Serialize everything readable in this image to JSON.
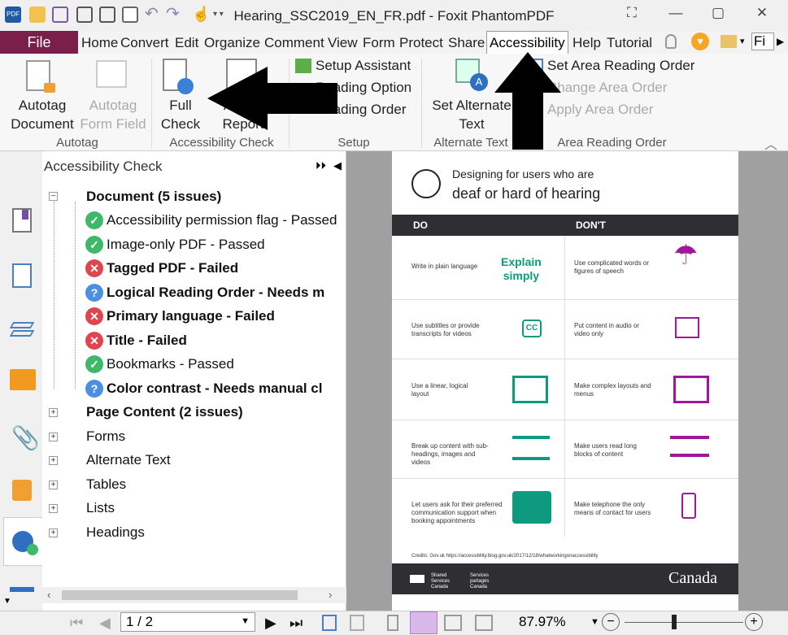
{
  "window": {
    "title": "Hearing_SSC2019_EN_FR.pdf - Foxit PhantomPDF",
    "search_tab": "Fi"
  },
  "menu": {
    "file": "File",
    "items": [
      "Home",
      "Convert",
      "Edit",
      "Organize",
      "Comment",
      "View",
      "Form",
      "Protect",
      "Share"
    ],
    "active": "Accessibility",
    "after": [
      "Help",
      "Tutorial"
    ]
  },
  "ribbon": {
    "autotag_document": [
      "Autotag",
      "Document"
    ],
    "autotag_form_field": [
      "Autotag",
      "Form Field"
    ],
    "group_autotag": "Autotag",
    "full_check": [
      "Full",
      "Check"
    ],
    "accessibility_report": [
      "Acc",
      "Report"
    ],
    "group_check": "Accessibility Check",
    "setup_assistant": "Setup Assistant",
    "reading_option": "Reading Option",
    "reading_order": "Reading Order",
    "group_setup": "Setup",
    "set_alt_text": [
      "Set Alternate",
      "Text"
    ],
    "group_alt": "Alternate Text",
    "set_area_order": "Set Area Reading Order",
    "change_area_order": "Change Area Order",
    "apply_area_order": "Apply Area Order",
    "group_area": "Area Reading Order"
  },
  "panel": {
    "title": "Accessibility Check",
    "document_node": "Document (5 issues)",
    "checks": [
      {
        "label": "Accessibility permission flag - Passed",
        "status": "pass"
      },
      {
        "label": "Image-only PDF - Passed",
        "status": "pass"
      },
      {
        "label": "Tagged PDF - Failed",
        "status": "fail"
      },
      {
        "label": "Logical Reading Order - Needs m",
        "status": "manual"
      },
      {
        "label": "Primary language - Failed",
        "status": "fail"
      },
      {
        "label": "Title - Failed",
        "status": "fail"
      },
      {
        "label": "Bookmarks - Passed",
        "status": "pass"
      },
      {
        "label": "Color contrast - Needs manual cl",
        "status": "manual"
      }
    ],
    "page_content": "Page Content (2 issues)",
    "others": [
      "Forms",
      "Alternate Text",
      "Tables",
      "Lists",
      "Headings"
    ]
  },
  "doc": {
    "heading1": "Designing for users who are",
    "heading2": "deaf or hard of hearing",
    "col_do": "DO",
    "col_dont": "DON'T",
    "rows": [
      {
        "do": "Write in plain language",
        "dont": "Use complicated words or figures of speech"
      },
      {
        "do": "Use subtitles or provide transcripts for videos",
        "dont": "Put content in audio or video only"
      },
      {
        "do": "Use a linear, logical layout",
        "dont": "Make complex layouts and menus"
      },
      {
        "do": "Break up content with sub-headings, images and videos",
        "dont": "Make users read long blocks of content"
      },
      {
        "do": "Let users ask for their preferred communication support when booking appointments",
        "dont": "Make telephone the only means of contact for users"
      }
    ],
    "explain": [
      "Explain",
      "simply"
    ],
    "cc": "CC",
    "credits": "Credits: Gov.uk https://accessibility.blog.gov.uk/2017/12/18/whatworkingonaccessibility",
    "footer_en": "Shared Services Canada",
    "footer_fr": "Services partagés Canada",
    "canada": "Canada"
  },
  "status": {
    "page": "1 / 2",
    "zoom": "87.97%"
  }
}
